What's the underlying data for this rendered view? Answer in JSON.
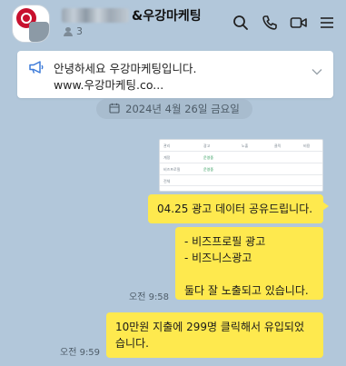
{
  "header": {
    "title_suffix": "&우강마케팅",
    "member_count": "3",
    "icons": [
      "search-icon",
      "call-icon",
      "video-icon",
      "menu-icon"
    ]
  },
  "notice": {
    "line1": "안녕하세요 우강마케팅입니다.",
    "line2": "www.우강마케팅.co..."
  },
  "date_divider": {
    "label": "2024년 4월 26일 금요일"
  },
  "image_message": {
    "preview_cells": [
      "관리",
      "광고",
      "노출",
      "클릭",
      "비용",
      "운영중",
      "운영중",
      "계정",
      "비즈프로필",
      "전체"
    ]
  },
  "messages": [
    {
      "lines": [
        "04.25 광고 데이터 공유드립니다."
      ]
    },
    {
      "lines": [
        "- 비즈프로필 광고",
        "- 비즈니스광고",
        "",
        "둘다 잘 노출되고 있습니다."
      ],
      "time": "오전 9:58"
    },
    {
      "lines": [
        "10만원 지출에 299명 클릭해서 유입되었",
        "습니다."
      ],
      "time": "오전 9:59"
    }
  ],
  "colors": {
    "background": "#b2c7da",
    "bubble_mine": "#fee94e",
    "logo_red": "#c8102e"
  }
}
